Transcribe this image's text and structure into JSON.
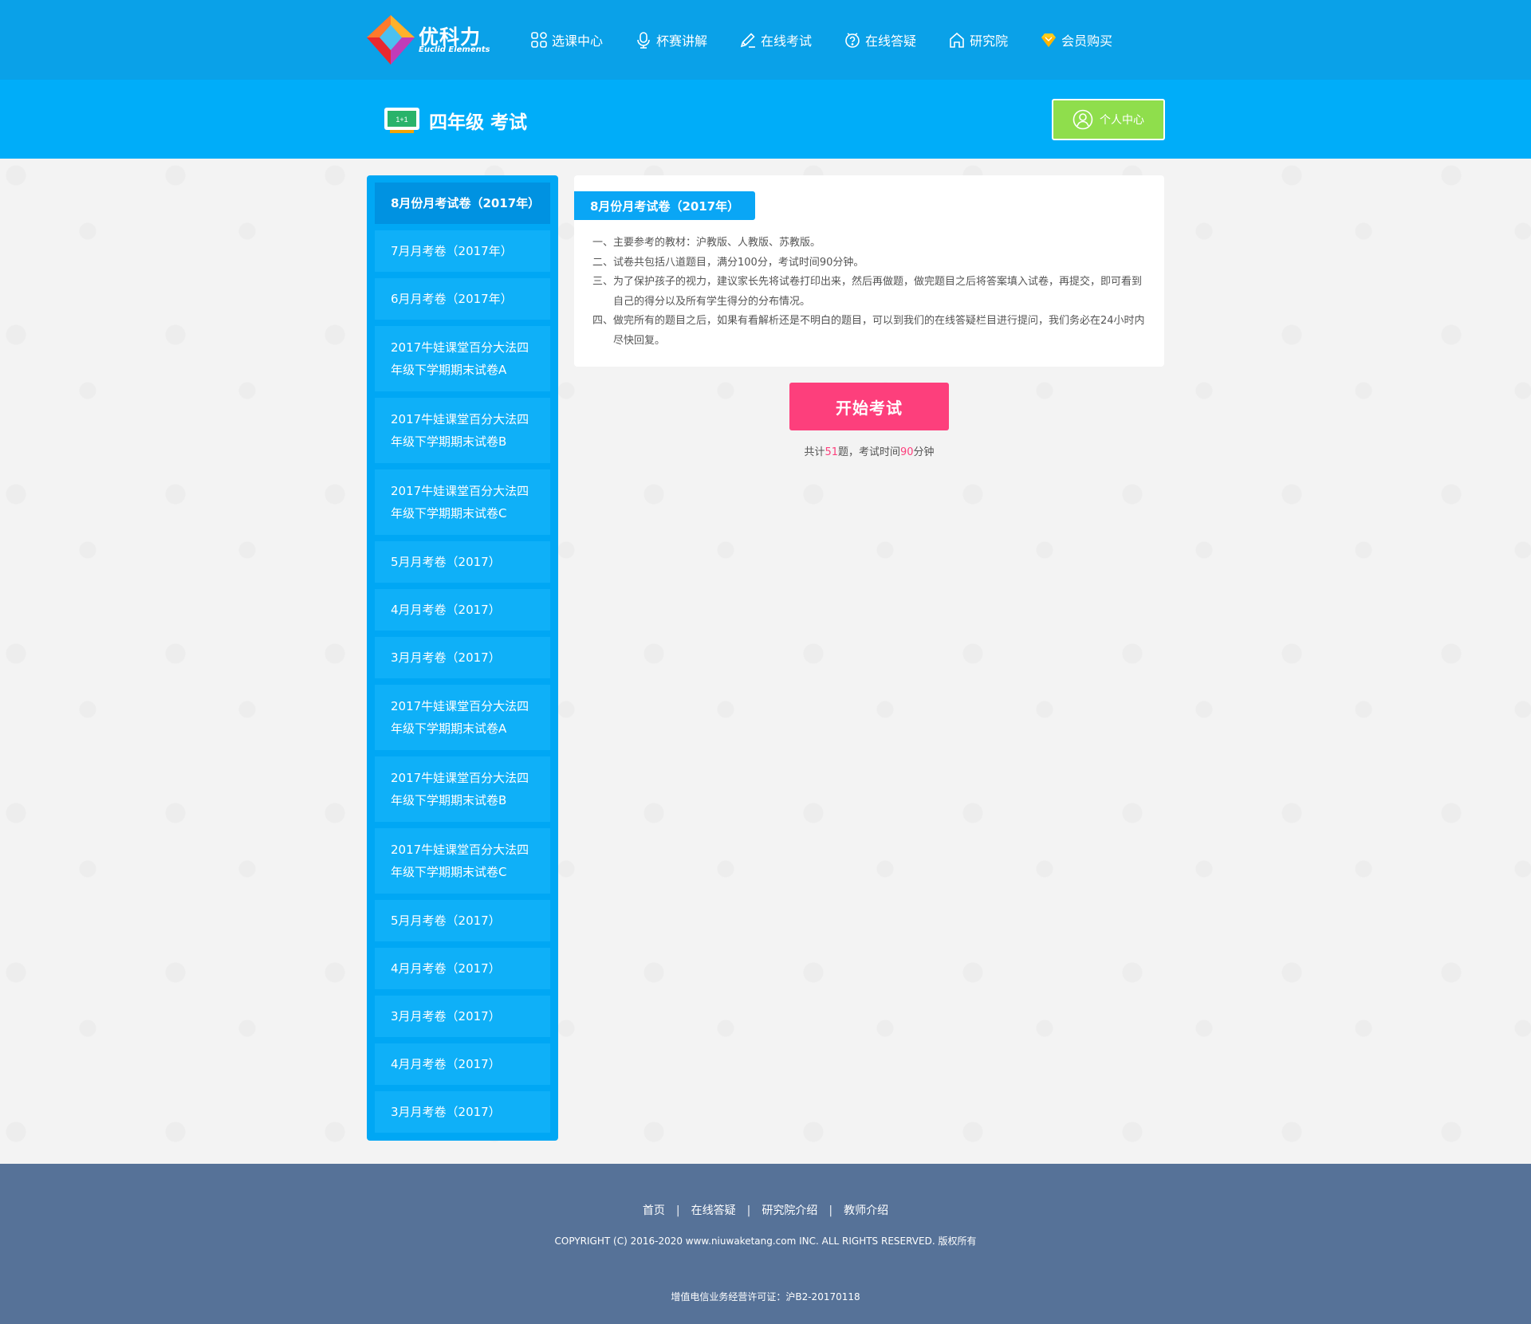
{
  "brand": {
    "name_cn": "优科力",
    "name_en": "Euclid Elements"
  },
  "nav": {
    "items": [
      {
        "label": "选课中心",
        "icon": "grid-icon"
      },
      {
        "label": "杯赛讲解",
        "icon": "microphone-icon"
      },
      {
        "label": "在线考试",
        "icon": "pencil-icon"
      },
      {
        "label": "在线答疑",
        "icon": "question-icon"
      },
      {
        "label": "研究院",
        "icon": "home-icon"
      },
      {
        "label": "会员购买",
        "icon": "diamond-icon"
      }
    ]
  },
  "header": {
    "title": "四年级 考试",
    "personal_center": "个人中心"
  },
  "sidebar": {
    "items": [
      {
        "label": "8月份月考试卷（2017年）",
        "active": true
      },
      {
        "label": "7月月考卷（2017年）"
      },
      {
        "label": "6月月考卷（2017年）"
      },
      {
        "label": "2017牛娃课堂百分大法四年级下学期期末试卷A"
      },
      {
        "label": "2017牛娃课堂百分大法四年级下学期期末试卷B"
      },
      {
        "label": "2017牛娃课堂百分大法四年级下学期期末试卷C"
      },
      {
        "label": "5月月考卷（2017）"
      },
      {
        "label": "4月月考卷（2017）"
      },
      {
        "label": "3月月考卷（2017）"
      },
      {
        "label": "2017牛娃课堂百分大法四年级下学期期末试卷A"
      },
      {
        "label": "2017牛娃课堂百分大法四年级下学期期末试卷B"
      },
      {
        "label": "2017牛娃课堂百分大法四年级下学期期末试卷C"
      },
      {
        "label": "5月月考卷（2017）"
      },
      {
        "label": "4月月考卷（2017）"
      },
      {
        "label": "3月月考卷（2017）"
      },
      {
        "label": "4月月考卷（2017）"
      },
      {
        "label": "3月月考卷（2017）"
      }
    ]
  },
  "exam": {
    "title": "8月份月考试卷（2017年）",
    "rules": [
      {
        "num": "一、",
        "text": "主要参考的教材：沪教版、人教版、苏教版。"
      },
      {
        "num": "二、",
        "text": "试卷共包括八道题目，满分100分，考试时间90分钟。"
      },
      {
        "num": "三、",
        "text": "为了保护孩子的视力，建议家长先将试卷打印出来，然后再做题，做完题目之后将答案填入试卷，再提交，即可看到自己的得分以及所有学生得分的分布情况。"
      },
      {
        "num": "四、",
        "text": "做完所有的题目之后，如果有看解析还是不明白的题目，可以到我们的在线答疑栏目进行提问，我们务必在24小时内尽快回复。"
      }
    ],
    "start_label": "开始考试",
    "meta_prefix": "共计",
    "question_count": "51",
    "meta_mid": "题，考试时间",
    "minutes": "90",
    "meta_suffix": "分钟"
  },
  "footer": {
    "links": [
      "首页",
      "在线答疑",
      "研究院介绍",
      "教师介绍"
    ],
    "separator": "|",
    "copyright": "COPYRIGHT (C) 2016-2020 www.niuwaketang.com INC. ALL RIGHTS RESERVED. 版权所有",
    "license": "增值电信业务经营许可证：沪B2-20170118"
  },
  "colors": {
    "topbar": "#0aa1e8",
    "subheader": "#00adf9",
    "sidebar": "#00a7f4",
    "accent_pink": "#fd3f7c",
    "personal_green": "#8fde4c",
    "footer": "#567298"
  }
}
